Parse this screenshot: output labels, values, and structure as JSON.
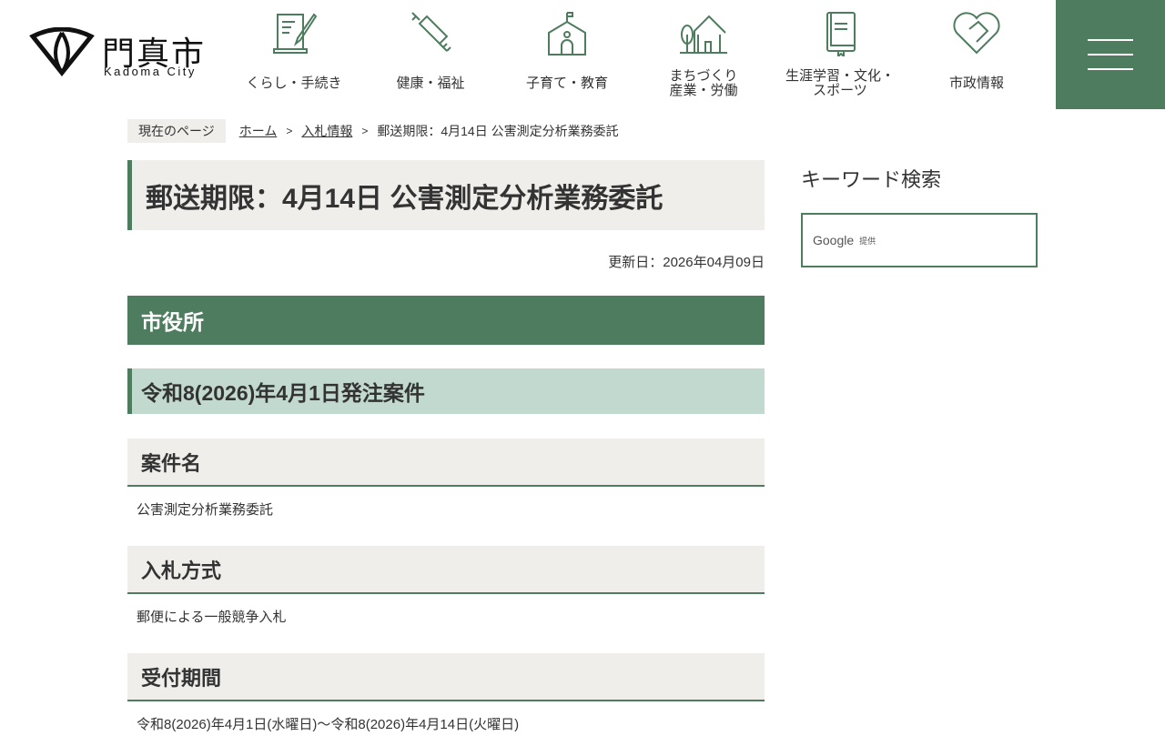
{
  "logo": {
    "jp": "門真市",
    "en": "Kadoma City"
  },
  "nav": [
    {
      "label": "くらし・手続き",
      "icon": "document-pen-icon"
    },
    {
      "label": "健康・福祉",
      "icon": "syringe-icon"
    },
    {
      "label": "子育て・教育",
      "icon": "school-icon"
    },
    {
      "label": "まちづくり\n産業・労働",
      "icon": "house-tree-icon"
    },
    {
      "label": "生涯学習・文化・\nスポーツ",
      "icon": "book-icon"
    },
    {
      "label": "市政情報",
      "icon": "heart-handshake-icon"
    }
  ],
  "breadcrumb": {
    "here": "現在のページ",
    "home": "ホーム",
    "parent": "入札情報",
    "current": "郵送期限：4月14日 公害測定分析業務委託"
  },
  "main": {
    "title": "郵送期限：4月14日 公害測定分析業務委託",
    "updated": "更新日：2026年04月09日",
    "h2": "市役所",
    "h3": "令和8(2026)年4月1日発注案件",
    "sections": [
      {
        "heading": "案件名",
        "text": "公害測定分析業務委託"
      },
      {
        "heading": "入札方式",
        "text": "郵便による一般競争入札"
      },
      {
        "heading": "受付期間",
        "text": "令和8(2026)年4月1日(水曜日)～令和8(2026)年4月14日(火曜日)"
      }
    ]
  },
  "sidebar": {
    "heading": "キーワード検索",
    "google": "Google",
    "provided": "提供"
  }
}
